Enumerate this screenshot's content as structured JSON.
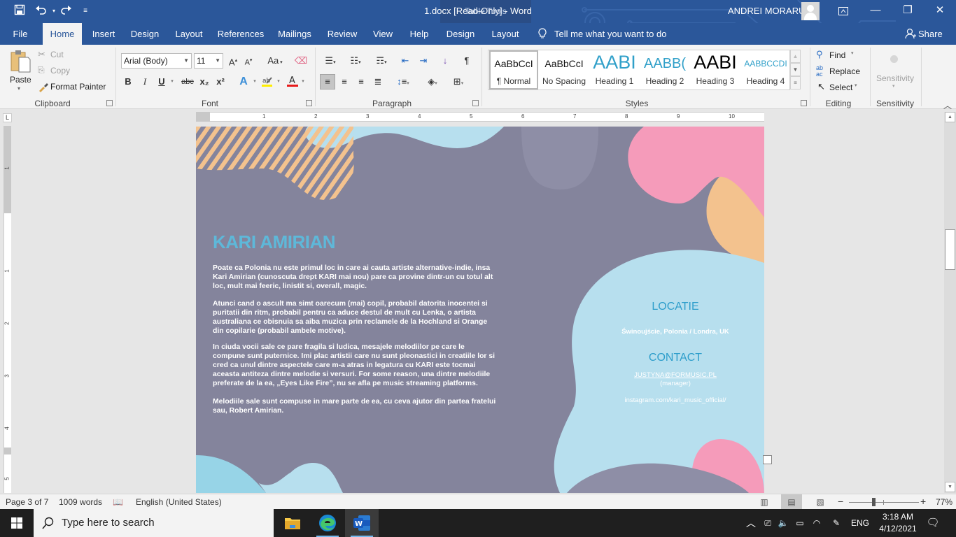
{
  "window": {
    "title": "1.docx [Read-Only]  -  Word",
    "contextual_group": "Table Tools",
    "user_name": "ANDREI MORARU",
    "controls": {
      "ribbon_display": "ribbon-display-options",
      "minimize": "—",
      "restore": "❐",
      "close": "✕"
    }
  },
  "quick_access": {
    "save": "save-icon",
    "undo": "undo-icon",
    "redo": "redo-icon",
    "customize": "customize-icon"
  },
  "tabs": [
    {
      "label": "File"
    },
    {
      "label": "Home",
      "active": true
    },
    {
      "label": "Insert"
    },
    {
      "label": "Design"
    },
    {
      "label": "Layout"
    },
    {
      "label": "References"
    },
    {
      "label": "Mailings"
    },
    {
      "label": "Review"
    },
    {
      "label": "View"
    },
    {
      "label": "Help"
    },
    {
      "label": "Design"
    },
    {
      "label": "Layout"
    }
  ],
  "tell_me": "Tell me what you want to do",
  "share": "Share",
  "ribbon": {
    "clipboard": {
      "label": "Clipboard",
      "paste": "Paste",
      "cut": "Cut",
      "copy": "Copy",
      "format_painter": "Format Painter"
    },
    "font": {
      "label": "Font",
      "font_name": "Arial (Body)",
      "font_size": "11",
      "change_case": "Aa",
      "bold": "B",
      "italic": "I",
      "underline": "U",
      "strikethrough": "abc",
      "subscript": "x₂",
      "superscript": "x²"
    },
    "paragraph": {
      "label": "Paragraph"
    },
    "styles": {
      "label": "Styles",
      "items": [
        {
          "sample": "AaBbCcI",
          "name": "¶ Normal",
          "active": true
        },
        {
          "sample": "AaBbCcI",
          "name": "No Spacing"
        },
        {
          "sample": "AABI",
          "name": "Heading 1"
        },
        {
          "sample": "AABB(",
          "name": "Heading 2"
        },
        {
          "sample": "AABI",
          "name": "Heading 3"
        },
        {
          "sample": "AABBCCDI",
          "name": "Heading 4"
        }
      ]
    },
    "editing": {
      "label": "Editing",
      "find": "Find",
      "replace": "Replace",
      "select": "Select"
    },
    "sensitivity": {
      "label": "Sensitivity",
      "button": "Sensitivity"
    }
  },
  "ruler": {
    "h_numbers": [
      "1",
      "2",
      "3",
      "4",
      "5",
      "6",
      "7",
      "8",
      "9",
      "10"
    ],
    "v_numbers": [
      "1",
      "1",
      "2",
      "3",
      "4",
      "5"
    ]
  },
  "document": {
    "title": "KARI AMIRIAN",
    "paragraphs": [
      "      Poate ca Polonia nu este primul loc in care ai cauta artiste alternative-indie, insa Kari Amirian (cunoscuta drept KARI mai nou) pare ca provine dintr-un cu totul alt loc, mult mai feeric, linistit si, overall, magic.",
      "   Atunci cand o ascult ma simt oarecum (mai) copil, probabil datorita inocentei si puritatii din ritm, probabil pentru ca aduce destul de mult cu Lenka, o artista australiana ce obisnuia sa aiba muzica prin reclamele de la Hochland si Orange din copilarie (probabil ambele motive).",
      "  In ciuda vocii sale ce pare fragila si ludica, mesajele melodiilor pe care le compune sunt puternice. Imi plac artistii care nu sunt pleonastici in creatiile lor si cred ca unul dintre aspectele care m-a atras in legatura cu KARI este tocmai aceasta antiteza dintre melodie si versuri. For some reason, una dintre melodiile preferate de la ea, „Eyes Like Fire”, nu se afla pe music streaming platforms.",
      "    Melodiile sale sunt compuse in mare parte de ea, cu ceva ajutor din partea fratelui sau, Robert Amirian."
    ],
    "sidebar": {
      "location_heading": "LOCATIE",
      "location": "Świnoujście, Polonia / Londra, UK",
      "contact_heading": "CONTACT",
      "email": "JUSTYNA@FORMUSIC.PL",
      "email_role": "(manager)",
      "instagram": "instagram.com/kari_music_official/"
    },
    "colors": {
      "background": "#84849c",
      "light_blue": "#b7dfee",
      "pink": "#f59bba",
      "peach": "#f3c28e",
      "title_blue": "#5eb8d9"
    }
  },
  "status": {
    "page": "Page 3 of 7",
    "words": "1009 words",
    "language": "English (United States)",
    "zoom": "77%",
    "zoom_minus": "−",
    "zoom_plus": "+"
  },
  "taskbar": {
    "search_placeholder": "Type here to search",
    "language": "ENG",
    "time": "3:18 AM",
    "date": "4/12/2021"
  }
}
